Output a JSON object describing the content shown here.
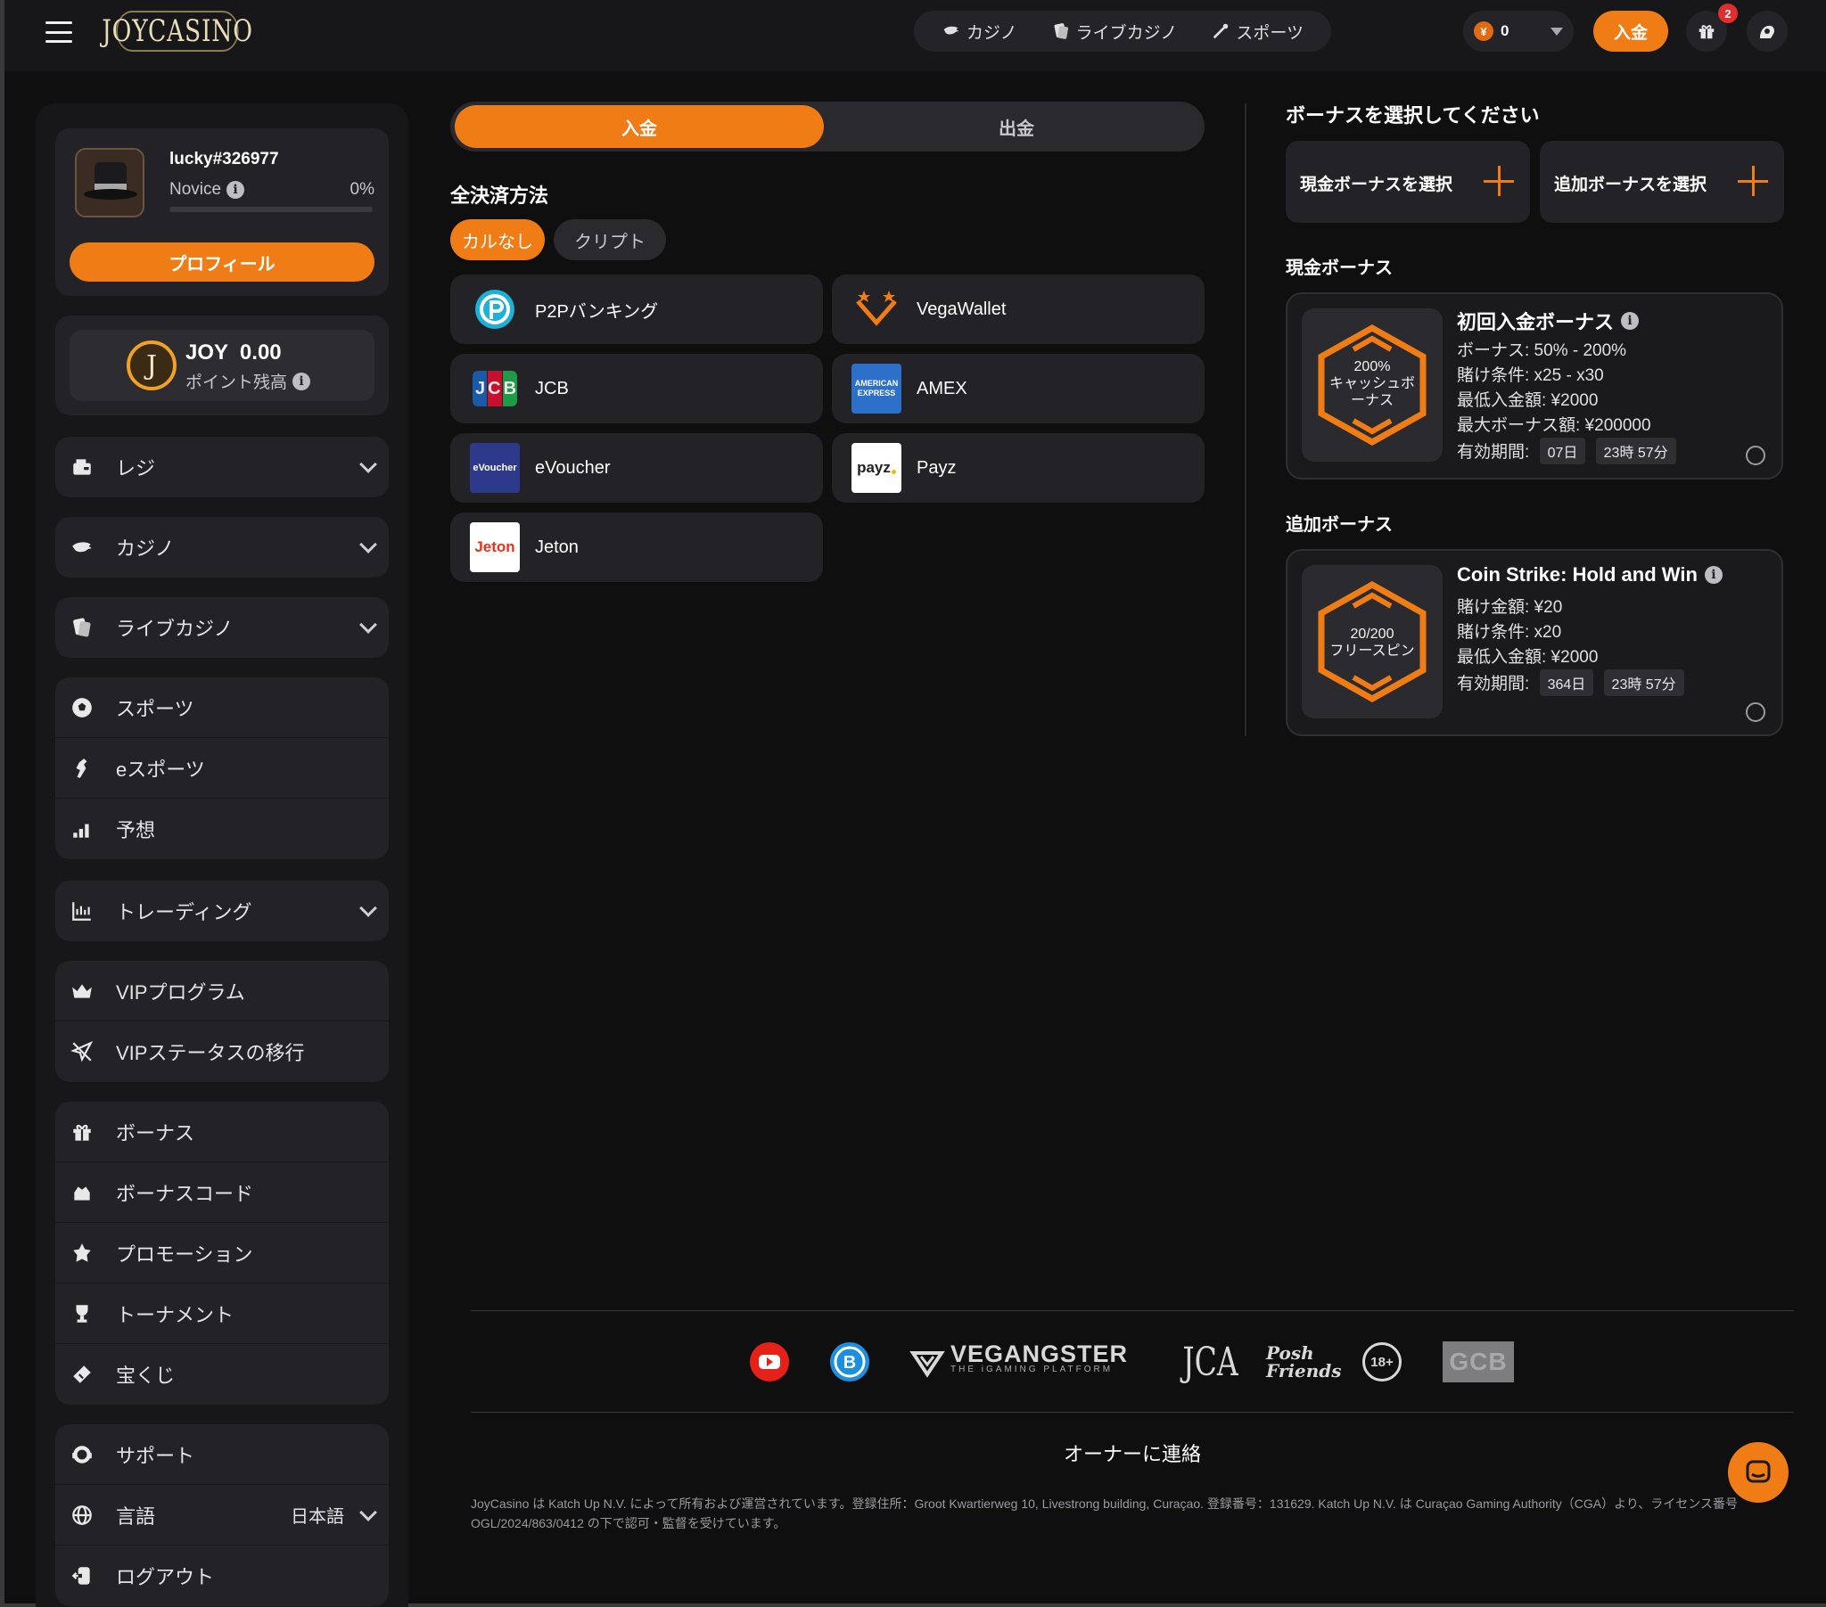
{
  "header": {
    "logo_text": "JOYCASINO",
    "nav": [
      {
        "label": "カジノ",
        "icon": "casino-icon"
      },
      {
        "label": "ライブカジノ",
        "icon": "live-casino-icon"
      },
      {
        "label": "スポーツ",
        "icon": "sports-icon"
      }
    ],
    "balance": "0",
    "currency_symbol": "¥",
    "deposit_label": "入金",
    "gift_badge": "2"
  },
  "profile": {
    "username": "lucky#326977",
    "rank": "Novice",
    "progress_text": "0%",
    "progress_fraction": 0,
    "profile_button": "プロフィール"
  },
  "joy": {
    "coin_letter": "J",
    "value": "JOY  0.00",
    "label": "ポイント残高"
  },
  "sidebar": {
    "group1": [
      {
        "label": "レジ",
        "icon": "cashier-icon",
        "expandable": true
      }
    ],
    "group2": [
      {
        "label": "カジノ",
        "icon": "casino-icon",
        "expandable": true
      }
    ],
    "group3": [
      {
        "label": "ライブカジノ",
        "icon": "live-casino-icon",
        "expandable": true
      }
    ],
    "group4": [
      {
        "label": "スポーツ",
        "icon": "soccer-ball-icon"
      },
      {
        "label": "eスポーツ",
        "icon": "esports-icon"
      },
      {
        "label": "予想",
        "icon": "predictions-icon"
      }
    ],
    "group5": [
      {
        "label": "トレーディング",
        "icon": "trading-icon",
        "expandable": true
      }
    ],
    "group6": [
      {
        "label": "VIPプログラム",
        "icon": "crown-icon"
      },
      {
        "label": "VIPステータスの移行",
        "icon": "plane-icon"
      }
    ],
    "group7": [
      {
        "label": "ボーナス",
        "icon": "gift-icon"
      },
      {
        "label": "ボーナスコード",
        "icon": "bonus-code-icon"
      },
      {
        "label": "プロモーション",
        "icon": "promotion-icon"
      },
      {
        "label": "トーナメント",
        "icon": "trophy-icon"
      },
      {
        "label": "宝くじ",
        "icon": "ticket-icon"
      }
    ],
    "group8": [
      {
        "label": "サポート",
        "icon": "support-icon"
      },
      {
        "label": "言語",
        "icon": "globe-icon",
        "value": "日本語"
      },
      {
        "label": "ログアウト",
        "icon": "logout-icon"
      }
    ]
  },
  "main": {
    "tabs": [
      "入金",
      "出金"
    ],
    "methods_title": "全決済方法",
    "chips": [
      "カルなし",
      "クリプト"
    ],
    "payment_methods": [
      {
        "name": "P2Pバンキング",
        "icon": "p2p-logo"
      },
      {
        "name": "VegaWallet",
        "icon": "vegawallet-logo"
      },
      {
        "name": "JCB",
        "icon": "jcb-logo"
      },
      {
        "name": "AMEX",
        "icon": "amex-logo"
      },
      {
        "name": "eVoucher",
        "icon": "evoucher-logo"
      },
      {
        "name": "Payz",
        "icon": "payz-logo"
      },
      {
        "name": "Jeton",
        "icon": "jeton-logo"
      }
    ],
    "logo_texts": {
      "jcb": "JCB",
      "amex_1": "AMERICAN",
      "amex_2": "EXPRESS",
      "evoucher": "eVoucher",
      "payz": "payz",
      "jeton": "Jeton"
    }
  },
  "bonus": {
    "title": "ボーナスを選択してください",
    "select_cash": "現金ボーナスを選択",
    "select_extra": "追加ボーナスを選択",
    "cash_title": "現金ボーナス",
    "extra_title": "追加ボーナス",
    "cash_card": {
      "badge_lines": [
        "200%",
        "キャッシュボ",
        "ーナス"
      ],
      "name": "初回入金ボーナス",
      "lines": [
        "ボーナス: 50% - 200%",
        "賭け条件: x25 - x30",
        "最低入金額: ¥2000",
        "最大ボーナス額: ¥200000"
      ],
      "validity_label": "有効期間:",
      "validity": [
        "07日",
        "23時 57分"
      ]
    },
    "extra_card": {
      "badge_lines": [
        "20/200",
        "フリースピン"
      ],
      "name": "Coin Strike: Hold and Win",
      "lines": [
        "賭け金額: ¥20",
        "賭け条件: x20",
        "最低入金額: ¥2000"
      ],
      "validity_label": "有効期間:",
      "validity": [
        "364日",
        "23時 57分"
      ]
    }
  },
  "footer": {
    "partner_logos": [
      "youtube-logo",
      "b-logo",
      "vegangster-logo",
      "jca-logo",
      "posh-friends-logo",
      "18-plus-logo",
      "gcb-logo"
    ],
    "vegangster": "VEGANGSTER",
    "vegangster_sub": "THE iGAMING PLATFORM",
    "jca": "JCA",
    "posh": "Posh",
    "friends": "Friends",
    "age": "18+",
    "gcb": "GCB",
    "contact_owner": "オーナーに連絡",
    "legal": "JoyCasino は Katch Up N.V. によって所有および運営されています。登録住所：Groot Kwartierweg 10, Livestrong building, Curaçao. 登録番号：131629. Katch Up N.V. は Curaçao Gaming Authority（CGA）より、ライセンス番号 OGL/2024/863/0412 の下で認可・監督を受けています。"
  },
  "colors": {
    "accent": "#f07c16",
    "background": "#0f0f10",
    "panel": "#17171a",
    "card": "#232327"
  }
}
